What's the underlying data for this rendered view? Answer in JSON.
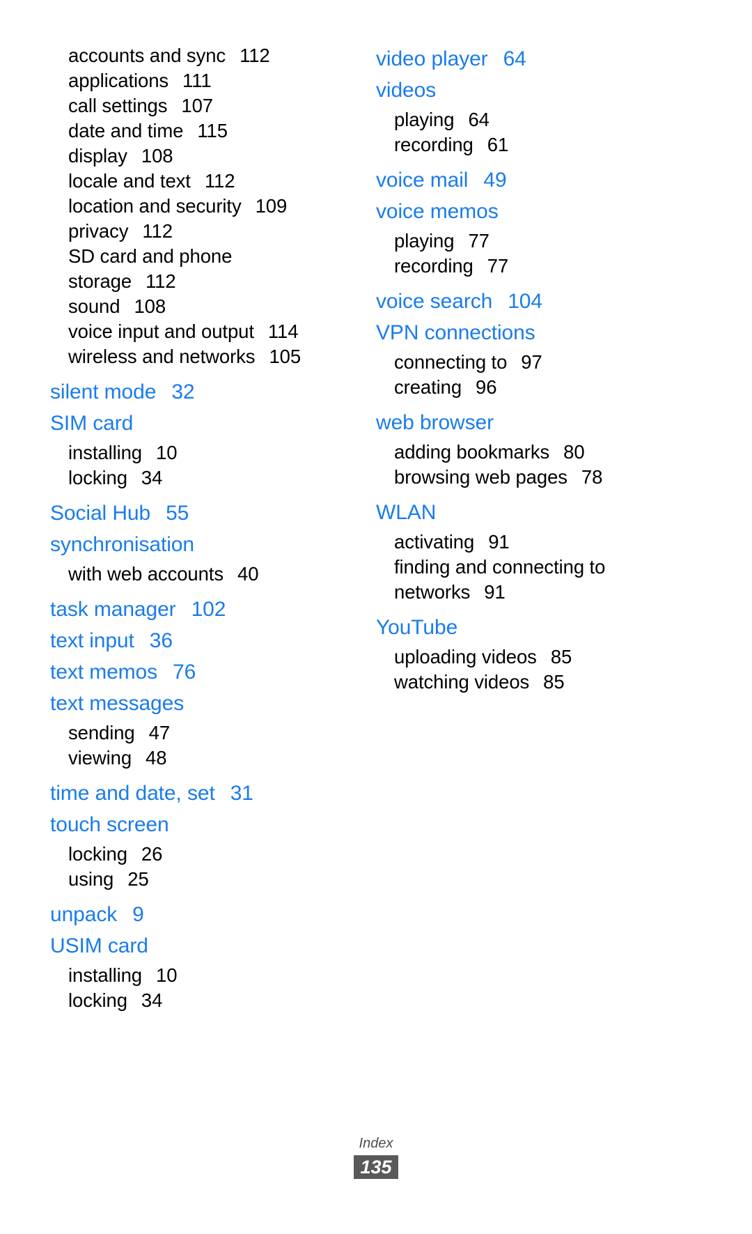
{
  "page": {
    "kind": "printed-manual-index",
    "footer_label": "Index",
    "page_number": "135",
    "heading_color": "#1a7ceb",
    "body_color": "#000000",
    "page_badge_color": "#595959"
  },
  "columns": [
    {
      "name": "left-column",
      "entries": [
        {
          "type": "sub",
          "label": "accounts and sync",
          "page": "112"
        },
        {
          "type": "sub",
          "label": "applications",
          "page": "111"
        },
        {
          "type": "sub",
          "label": "call settings",
          "page": "107"
        },
        {
          "type": "sub",
          "label": "date and time",
          "page": "115"
        },
        {
          "type": "sub",
          "label": "display",
          "page": "108"
        },
        {
          "type": "sub",
          "label": "locale and text",
          "page": "112"
        },
        {
          "type": "sub",
          "label": "location and security",
          "page": "109"
        },
        {
          "type": "sub",
          "label": "privacy",
          "page": "112"
        },
        {
          "type": "sub",
          "label": "SD card and phone",
          "page": ""
        },
        {
          "type": "sub-cont",
          "label": "storage",
          "page": "112"
        },
        {
          "type": "sub",
          "label": "sound",
          "page": "108"
        },
        {
          "type": "sub",
          "label": "voice input and output",
          "page": "114"
        },
        {
          "type": "sub",
          "label": "wireless and networks",
          "page": "105"
        },
        {
          "type": "heading",
          "label": "silent mode",
          "page": "32"
        },
        {
          "type": "heading",
          "label": "SIM card",
          "page": ""
        },
        {
          "type": "sub",
          "label": "installing",
          "page": "10"
        },
        {
          "type": "sub",
          "label": "locking",
          "page": "34"
        },
        {
          "type": "heading",
          "label": "Social Hub",
          "page": "55"
        },
        {
          "type": "heading",
          "label": "synchronisation",
          "page": ""
        },
        {
          "type": "sub",
          "label": "with web accounts",
          "page": "40"
        },
        {
          "type": "heading",
          "label": "task manager",
          "page": "102"
        },
        {
          "type": "heading",
          "label": "text input",
          "page": "36"
        },
        {
          "type": "heading",
          "label": "text memos",
          "page": "76"
        },
        {
          "type": "heading",
          "label": "text messages",
          "page": ""
        },
        {
          "type": "sub",
          "label": "sending",
          "page": "47"
        },
        {
          "type": "sub",
          "label": "viewing",
          "page": "48"
        },
        {
          "type": "heading",
          "label": "time and date, set",
          "page": "31"
        },
        {
          "type": "heading",
          "label": "touch screen",
          "page": ""
        },
        {
          "type": "sub",
          "label": "locking",
          "page": "26"
        },
        {
          "type": "sub",
          "label": "using",
          "page": "25"
        },
        {
          "type": "heading",
          "label": "unpack",
          "page": "9"
        },
        {
          "type": "heading",
          "label": "USIM card",
          "page": ""
        },
        {
          "type": "sub",
          "label": "installing",
          "page": "10"
        },
        {
          "type": "sub",
          "label": "locking",
          "page": "34"
        }
      ]
    },
    {
      "name": "right-column",
      "entries": [
        {
          "type": "heading",
          "label": "video player",
          "page": "64"
        },
        {
          "type": "heading",
          "label": "videos",
          "page": ""
        },
        {
          "type": "sub",
          "label": "playing",
          "page": "64"
        },
        {
          "type": "sub",
          "label": "recording",
          "page": "61"
        },
        {
          "type": "heading",
          "label": "voice mail",
          "page": "49"
        },
        {
          "type": "heading",
          "label": "voice memos",
          "page": ""
        },
        {
          "type": "sub",
          "label": "playing",
          "page": "77"
        },
        {
          "type": "sub",
          "label": "recording",
          "page": "77"
        },
        {
          "type": "heading",
          "label": "voice search",
          "page": "104"
        },
        {
          "type": "heading",
          "label": "VPN connections",
          "page": ""
        },
        {
          "type": "sub",
          "label": "connecting to",
          "page": "97"
        },
        {
          "type": "sub",
          "label": "creating",
          "page": "96"
        },
        {
          "type": "heading",
          "label": "web browser",
          "page": ""
        },
        {
          "type": "sub",
          "label": "adding bookmarks",
          "page": "80"
        },
        {
          "type": "sub",
          "label": "browsing web pages",
          "page": "78"
        },
        {
          "type": "heading",
          "label": "WLAN",
          "page": ""
        },
        {
          "type": "sub",
          "label": "activating",
          "page": "91"
        },
        {
          "type": "sub",
          "label": "finding and connecting to",
          "page": ""
        },
        {
          "type": "sub-cont",
          "label": "networks",
          "page": "91"
        },
        {
          "type": "heading",
          "label": "YouTube",
          "page": ""
        },
        {
          "type": "sub",
          "label": "uploading videos",
          "page": "85"
        },
        {
          "type": "sub",
          "label": "watching videos",
          "page": "85"
        }
      ]
    }
  ]
}
